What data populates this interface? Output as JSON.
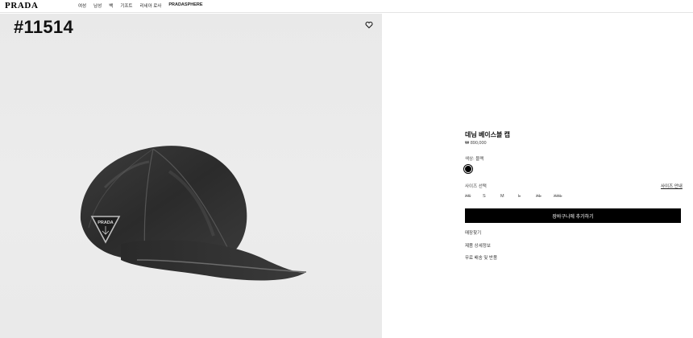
{
  "header": {
    "logo": "PRADA",
    "nav": [
      "여성",
      "남성",
      "백",
      "기프트",
      "리네아 로사",
      "PRADASPHERE"
    ]
  },
  "image": {
    "watermark": "#11514",
    "badge_text": "PRADA"
  },
  "product": {
    "title": "데님 베이스볼 캡",
    "price": "₩ 890,000",
    "color_label": "색상: 블랙",
    "size_label": "사이즈 선택",
    "size_guide": "사이즈 안내",
    "sizes": [
      {
        "label": "XS",
        "available": false
      },
      {
        "label": "S",
        "available": true
      },
      {
        "label": "M",
        "available": true
      },
      {
        "label": "L",
        "available": false
      },
      {
        "label": "XL",
        "available": false
      },
      {
        "label": "XXL",
        "available": false
      }
    ],
    "add_to_cart": "장바구니에 추가하기",
    "links": [
      "매장찾기",
      "제품 상세정보",
      "무료 배송 및 반품"
    ]
  },
  "colors": {
    "swatch": "#000000",
    "button_bg": "#000000",
    "image_bg": "#ebebeb"
  }
}
